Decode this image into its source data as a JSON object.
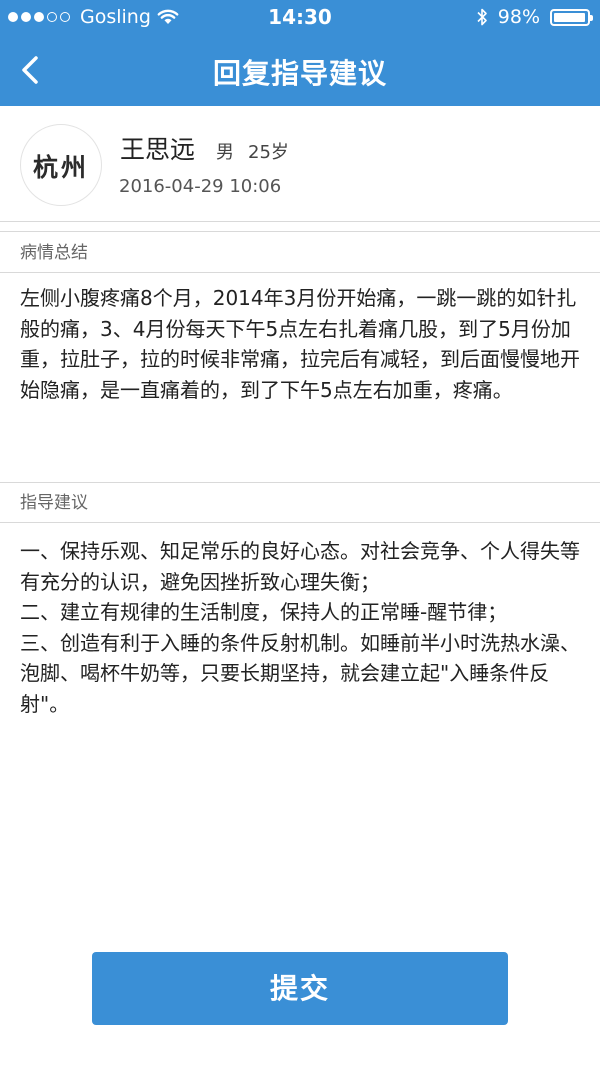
{
  "status_bar": {
    "carrier": "Gosling",
    "time": "14:30",
    "battery": "98%",
    "battery_level": 0.98,
    "signal_bars_filled": 3,
    "signal_bars_total": 5
  },
  "nav": {
    "title": "回复指导建议",
    "back_icon": "chevron-left-icon"
  },
  "patient": {
    "avatar_text": "杭州",
    "name": "王思远",
    "gender": "男",
    "age": "25岁",
    "datetime": "2016-04-29 10:06"
  },
  "summary": {
    "label": "病情总结",
    "text": "左侧小腹疼痛8个月，2014年3月份开始痛，一跳一跳的如针扎般的痛，3、4月份每天下午5点左右扎着痛几股，到了5月份加重，拉肚子，拉的时候非常痛，拉完后有减轻，到后面慢慢地开始隐痛，是一直痛着的，到了下午5点左右加重，疼痛。"
  },
  "advice": {
    "label": "指导建议",
    "text": "一、保持乐观、知足常乐的良好心态。对社会竞争、个人得失等有充分的认识，避免因挫折致心理失衡；\n二、建立有规律的生活制度，保持人的正常睡-醒节律；\n三、创造有利于入睡的条件反射机制。如睡前半小时洗热水澡、泡脚、喝杯牛奶等，只要长期坚持，就会建立起\"入睡条件反射\"。"
  },
  "submit_label": "提交",
  "colors": {
    "primary": "#3a8fd6",
    "text": "#222222",
    "muted": "#666666",
    "divider": "#d9d9d9"
  }
}
